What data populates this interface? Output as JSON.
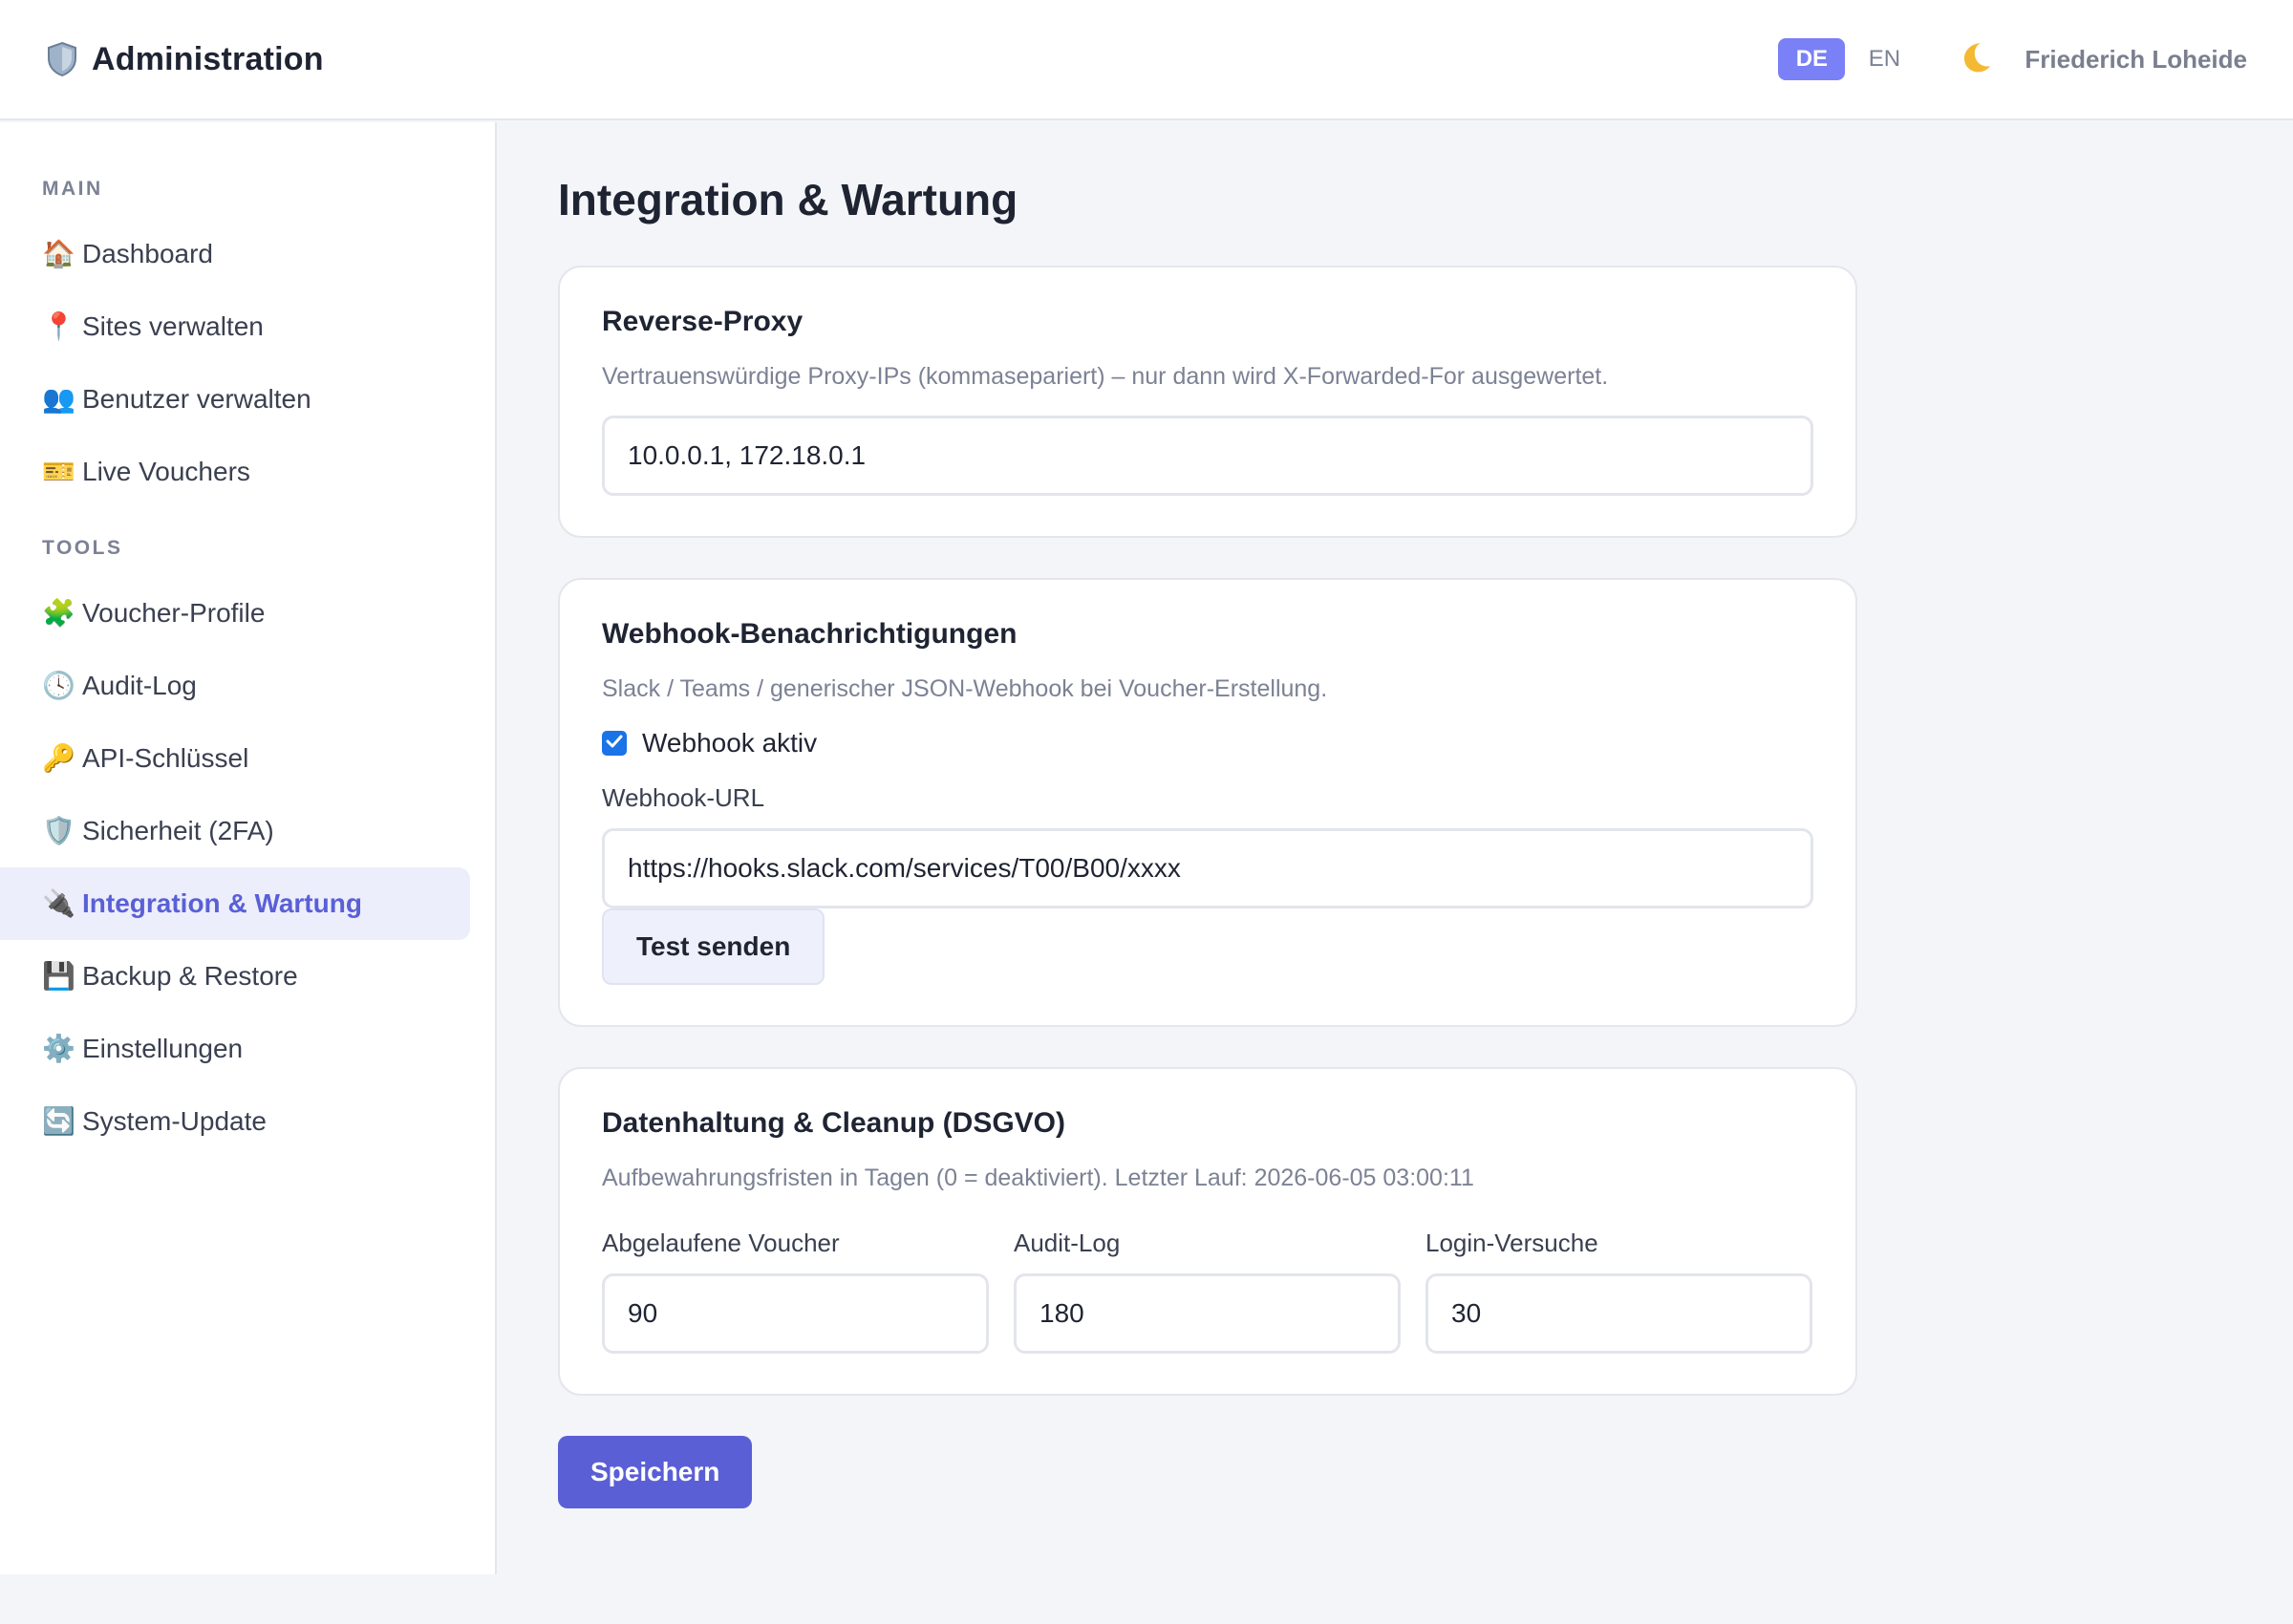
{
  "header": {
    "brand_icon": "shield-icon",
    "title": "Administration",
    "lang_de": "DE",
    "lang_en": "EN",
    "active_lang": "DE",
    "theme_icon": "moon-icon",
    "user_name": "Friederich Loheide"
  },
  "sidebar": {
    "section_main": "MAIN",
    "section_tools": "TOOLS",
    "main_items": [
      {
        "icon": "🏠",
        "icon_name": "house-icon",
        "label": "Dashboard"
      },
      {
        "icon": "📍",
        "icon_name": "pin-icon",
        "label": "Sites verwalten"
      },
      {
        "icon": "👥",
        "icon_name": "users-icon",
        "label": "Benutzer verwalten"
      },
      {
        "icon": "🎫",
        "icon_name": "ticket-icon",
        "label": "Live Vouchers"
      }
    ],
    "tool_items": [
      {
        "icon": "🧩",
        "icon_name": "puzzle-icon",
        "label": "Voucher-Profile"
      },
      {
        "icon": "🕓",
        "icon_name": "clock-icon",
        "label": "Audit-Log"
      },
      {
        "icon": "🔑",
        "icon_name": "key-icon",
        "label": "API-Schlüssel"
      },
      {
        "icon": "🛡️",
        "icon_name": "shield-icon",
        "label": "Sicherheit (2FA)"
      },
      {
        "icon": "🔌",
        "icon_name": "plug-icon",
        "label": "Integration & Wartung",
        "active": true
      },
      {
        "icon": "💾",
        "icon_name": "floppy-disk-icon",
        "label": "Backup & Restore"
      },
      {
        "icon": "⚙️",
        "icon_name": "gear-icon",
        "label": "Einstellungen"
      },
      {
        "icon": "🔄",
        "icon_name": "refresh-icon",
        "label": "System-Update"
      }
    ]
  },
  "main": {
    "page_title": "Integration & Wartung",
    "proxy": {
      "title": "Reverse-Proxy",
      "description": "Vertrauenswürdige Proxy-IPs (kommasepariert) – nur dann wird X-Forwarded-For ausgewertet.",
      "value": "10.0.0.1, 172.18.0.1"
    },
    "webhook": {
      "title": "Webhook-Benachrichtigungen",
      "description": "Slack / Teams / generischer JSON-Webhook bei Voucher-Erstellung.",
      "enabled_label": "Webhook aktiv",
      "enabled": true,
      "url_label": "Webhook-URL",
      "url_value": "https://hooks.slack.com/services/T00/B00/xxxx",
      "test_button": "Test senden"
    },
    "retention": {
      "title": "Datenhaltung & Cleanup (DSGVO)",
      "description": "Aufbewahrungsfristen in Tagen (0 = deaktiviert). Letzter Lauf: 2026-06-05 03:00:11",
      "expired_vouchers_label": "Abgelaufene Voucher",
      "expired_vouchers_value": "90",
      "audit_log_label": "Audit-Log",
      "audit_log_value": "180",
      "login_attempts_label": "Login-Versuche",
      "login_attempts_value": "30"
    },
    "save_button": "Speichern"
  },
  "colors": {
    "accent": "#5a5fd6",
    "lang_active": "#7a80f5",
    "active_nav_bg": "#eceefc",
    "checkbox": "#1a73e8"
  }
}
